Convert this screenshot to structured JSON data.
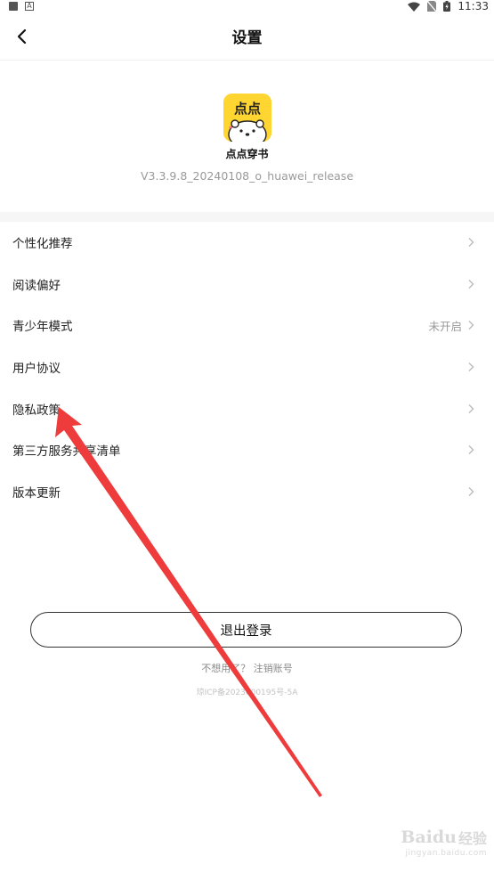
{
  "status_bar": {
    "time": "11:33"
  },
  "header": {
    "title": "设置"
  },
  "app": {
    "logo_text": "点点",
    "name": "点点穿书",
    "version": "V3.3.9.8_20240108_o_huawei_release"
  },
  "menu": {
    "items": [
      {
        "label": "个性化推荐",
        "value": ""
      },
      {
        "label": "阅读偏好",
        "value": ""
      },
      {
        "label": "青少年模式",
        "value": "未开启"
      },
      {
        "label": "用户协议",
        "value": ""
      },
      {
        "label": "隐私政策",
        "value": ""
      },
      {
        "label": "第三方服务共享清单",
        "value": ""
      },
      {
        "label": "版本更新",
        "value": ""
      }
    ]
  },
  "footer": {
    "logout_label": "退出登录",
    "cancel_prompt": "不想用了？",
    "cancel_link": "注销账号",
    "icp": "琼ICP备2023000195号-5A"
  },
  "watermark": {
    "brand": "Baidu",
    "brand_suffix": "经验",
    "url": "jingyan.baidu.com"
  },
  "colors": {
    "accent_yellow": "#ffd531",
    "annotation_red": "#ee3b3b"
  },
  "icons": [
    "back-arrow-icon",
    "chevron-right-icon",
    "wifi-icon",
    "no-sim-icon",
    "battery-icon",
    "bear-logo-icon",
    "annotation-arrow-icon"
  ]
}
